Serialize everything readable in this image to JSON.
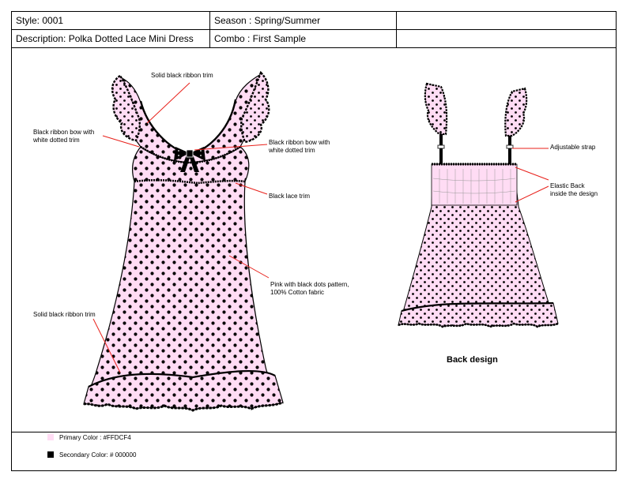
{
  "header": {
    "style": "Style: 0001",
    "season": "Season : Spring/Summer",
    "description": "Description: Polka Dotted Lace Mini Dress",
    "combo": "Combo : First Sample"
  },
  "annotations": {
    "front_ribbon_trim_top": "Solid black ribbon trim",
    "front_bow_left": "Black ribbon bow with\nwhite dotted trim",
    "front_bow_right": "Black ribbon bow with\nwhite dotted trim",
    "lace_trim": "Black lace trim",
    "fabric": "Pink with black dots pattern,\n100% Cotton fabric",
    "front_ribbon_trim_bottom": "Solid black ribbon trim",
    "adjustable_strap": "Adjustable strap",
    "elastic_back": "Elastic Back\ninside the design"
  },
  "back_design_label": "Back design",
  "colors": {
    "primary_label": "Primary Color : #FFDCF4",
    "primary_hex": "#FFDCF4",
    "secondary_label": "Secondary Color: # 000000",
    "secondary_hex": "#000000",
    "leader_line": "#e8201a"
  }
}
